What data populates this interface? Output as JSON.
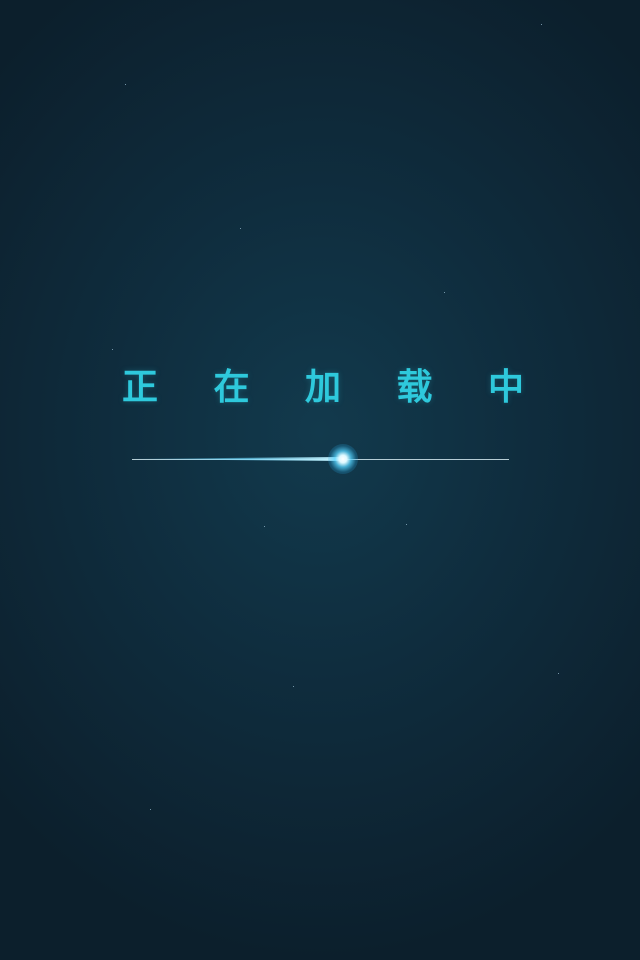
{
  "loading": {
    "chars": [
      "正",
      "在",
      "加",
      "载",
      "中"
    ],
    "progress": 0.56
  },
  "colors": {
    "background": "#0f2d3e",
    "title": "#2ec9dc",
    "progress_glow": "#56d4ff",
    "track": "#d3e8ef"
  }
}
